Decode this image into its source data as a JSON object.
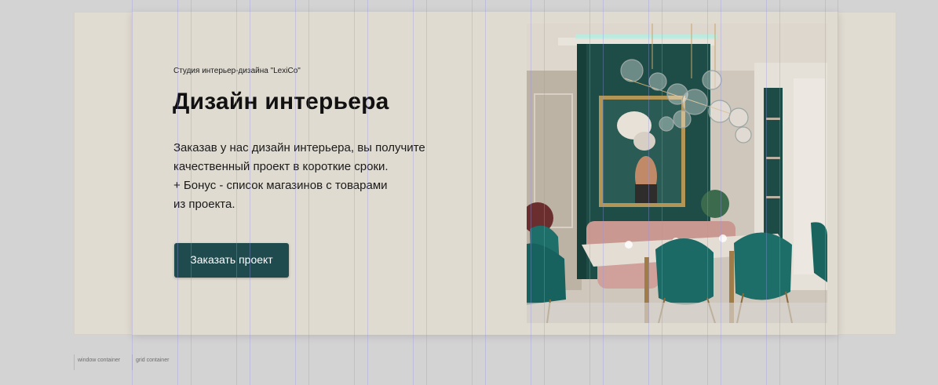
{
  "hero": {
    "eyebrow": "Студия интерьер-дизайна \"LexiCo\"",
    "title": "Дизайн интерьера",
    "description_lines": [
      "Заказав у нас дизайн интерьера, вы получите",
      "качественный проект в короткие сроки.",
      "+ Бонус - список магазинов с товарами",
      "из проекта."
    ],
    "cta_label": "Заказать проект",
    "image_alt": "interior dining room with emerald chairs and bubble chandelier"
  },
  "debug_labels": {
    "window": "window container",
    "grid": "grid container"
  },
  "colors": {
    "page_bg": "#d4d3d4",
    "section_bg": "#e1dcd2",
    "button_bg": "#1f4a4e",
    "button_text": "#ffffff",
    "grid_line": "#9696eb"
  }
}
